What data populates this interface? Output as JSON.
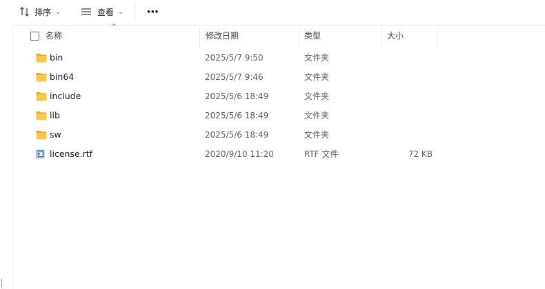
{
  "toolbar": {
    "sort_label": "排序",
    "view_label": "查看",
    "more_label": "···"
  },
  "columns": {
    "name": "名称",
    "date": "修改日期",
    "type": "类型",
    "size": "大小"
  },
  "files": [
    {
      "name": "bin",
      "date": "2025/5/7 9:50",
      "type": "文件夹",
      "size": "",
      "icon": "folder-icon"
    },
    {
      "name": "bin64",
      "date": "2025/5/7 9:46",
      "type": "文件夹",
      "size": "",
      "icon": "folder-icon"
    },
    {
      "name": "include",
      "date": "2025/5/6 18:49",
      "type": "文件夹",
      "size": "",
      "icon": "folder-icon"
    },
    {
      "name": "lib",
      "date": "2025/5/6 18:49",
      "type": "文件夹",
      "size": "",
      "icon": "folder-icon"
    },
    {
      "name": "sw",
      "date": "2025/5/6 18:49",
      "type": "文件夹",
      "size": "",
      "icon": "folder-icon"
    },
    {
      "name": "license.rtf",
      "date": "2020/9/10 11:20",
      "type": "RTF 文件",
      "size": "72 KB",
      "icon": "rtf-file-icon"
    }
  ],
  "colors": {
    "folder": "#f8c74c",
    "folder_dark": "#e9a81f",
    "rtf_blue": "#1e5aa8"
  }
}
